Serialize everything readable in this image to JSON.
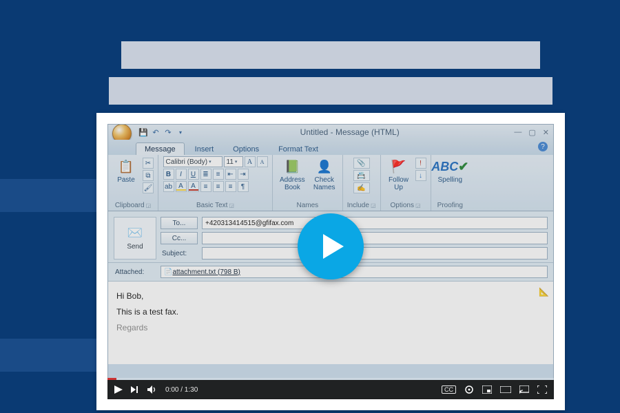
{
  "window": {
    "title": "Untitled - Message (HTML)"
  },
  "tabs": {
    "message": "Message",
    "insert": "Insert",
    "options": "Options",
    "format_text": "Format Text"
  },
  "ribbon": {
    "clipboard": {
      "paste": "Paste",
      "label": "Clipboard"
    },
    "basic_text": {
      "font_name": "Calibri (Body)",
      "font_size": "11",
      "label": "Basic Text"
    },
    "names": {
      "address_book": "Address\nBook",
      "check_names": "Check\nNames",
      "label": "Names"
    },
    "include": {
      "label": "Include"
    },
    "options_grp": {
      "follow_up": "Follow\nUp",
      "label": "Options"
    },
    "proofing": {
      "spelling": "Spelling",
      "label": "Proofing"
    }
  },
  "compose": {
    "send": "Send",
    "to_btn": "To...",
    "cc_btn": "Cc...",
    "subject_label": "Subject:",
    "attached_label": "Attached:",
    "to_value": "+420313414515@gfifax.com",
    "attachment_name": "attachment.txt (798 B)"
  },
  "body": {
    "line1": "Hi Bob,",
    "line2": "This is a test fax.",
    "line3": "Regards"
  },
  "video": {
    "time": "0:00 / 1:30",
    "cc": "CC"
  }
}
